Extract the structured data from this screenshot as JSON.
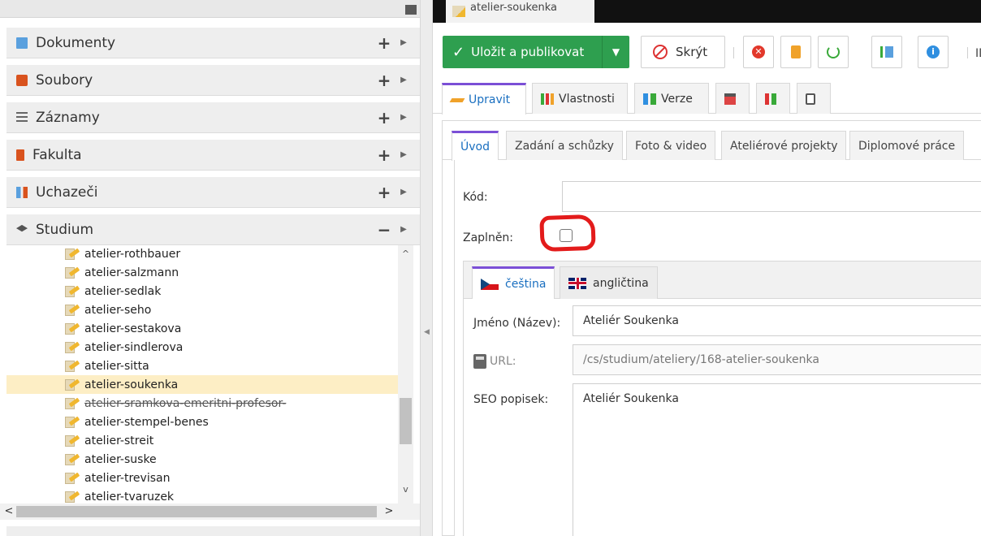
{
  "sidebar": {
    "sections": [
      {
        "label": "Dokumenty",
        "toggle": "+",
        "icon": "document-icon"
      },
      {
        "label": "Soubory",
        "toggle": "+",
        "icon": "files-icon"
      },
      {
        "label": "Záznamy",
        "toggle": "+",
        "icon": "records-icon"
      },
      {
        "label": "Fakulta",
        "toggle": "+",
        "icon": "faculty-icon"
      },
      {
        "label": "Uchazeči",
        "toggle": "+",
        "icon": "applicants-icon"
      },
      {
        "label": "Studium",
        "toggle": "−",
        "icon": "graduation-cap-icon"
      }
    ],
    "tree_items": [
      "atelier-rothbauer",
      "atelier-salzmann",
      "atelier-sedlak",
      "atelier-seho",
      "atelier-sestakova",
      "atelier-sindlerova",
      "atelier-sitta",
      "atelier-soukenka",
      "atelier-sramkova-emeritni-profesor-",
      "atelier-stempel-benes",
      "atelier-streit",
      "atelier-suske",
      "atelier-trevisan",
      "atelier-tvaruzek"
    ],
    "selected_item": "atelier-soukenka",
    "strikethrough_item": "atelier-sramkova-emeritni-profesor-",
    "scroll_up": "^",
    "scroll_down": "v",
    "scroll_left": "<",
    "scroll_right": ">"
  },
  "document_tab": {
    "title": "atelier-soukenka"
  },
  "toolbar": {
    "publish_label": "Uložit a publikovat",
    "hide_label": "Skrýt",
    "id_label": "ID"
  },
  "tabs": [
    {
      "label": "Upravit",
      "icon": "pencil-icon",
      "active": true
    },
    {
      "label": "Vlastnosti",
      "icon": "properties-icon"
    },
    {
      "label": "Verze",
      "icon": "versions-icon"
    },
    {
      "label": "",
      "icon": "calendar-icon"
    },
    {
      "label": "",
      "icon": "tree-icon"
    },
    {
      "label": "",
      "icon": "clipboard-icon"
    }
  ],
  "sub_tabs": [
    "Úvod",
    "Zadání a schůzky",
    "Foto & video",
    "Ateliérové projekty",
    "Diplomové práce"
  ],
  "form": {
    "kod_label": "Kód:",
    "kod_value": "",
    "zaplnen_label": "Zaplněn:",
    "zaplnen_checked": false
  },
  "lang_tabs": [
    {
      "label": "čeština",
      "active": true
    },
    {
      "label": "angličtina"
    }
  ],
  "lang_form": {
    "name_label": "Jméno (Název):",
    "name_value": "Ateliér Soukenka",
    "url_label": "URL:",
    "url_value": "/cs/studium/ateliery/168-atelier-soukenka",
    "seo_label": "SEO popisek:",
    "seo_value": "Ateliér Soukenka"
  },
  "colors": {
    "publish_green": "#2e9f4f",
    "active_tab_accent": "#7b4fd6",
    "selected_row": "#fdeec5",
    "annotation_red": "#e31b1b"
  }
}
